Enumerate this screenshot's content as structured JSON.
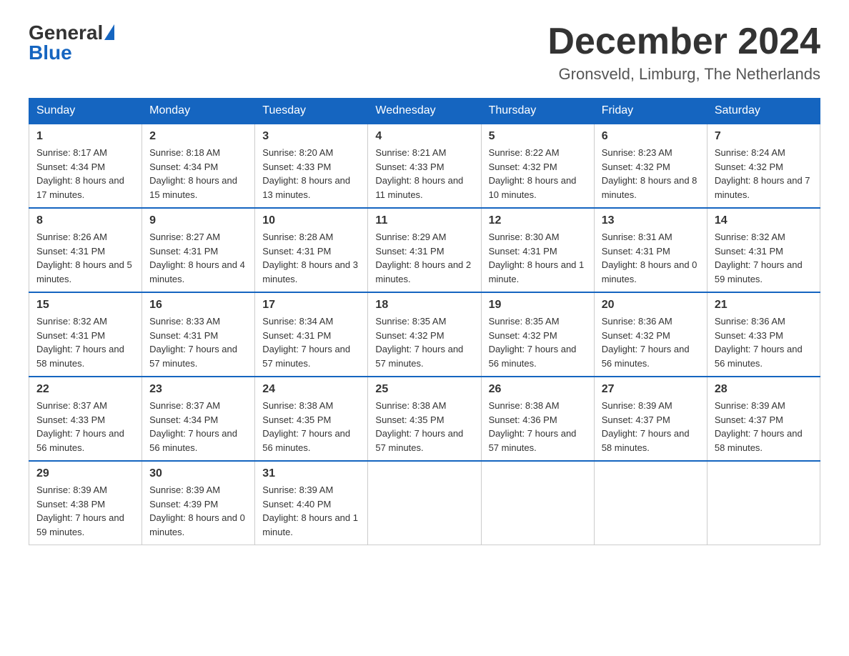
{
  "header": {
    "logo_general": "General",
    "logo_blue": "Blue",
    "month_title": "December 2024",
    "location": "Gronsveld, Limburg, The Netherlands"
  },
  "columns": [
    "Sunday",
    "Monday",
    "Tuesday",
    "Wednesday",
    "Thursday",
    "Friday",
    "Saturday"
  ],
  "weeks": [
    [
      {
        "day": "1",
        "sunrise": "8:17 AM",
        "sunset": "4:34 PM",
        "daylight": "8 hours and 17 minutes."
      },
      {
        "day": "2",
        "sunrise": "8:18 AM",
        "sunset": "4:34 PM",
        "daylight": "8 hours and 15 minutes."
      },
      {
        "day": "3",
        "sunrise": "8:20 AM",
        "sunset": "4:33 PM",
        "daylight": "8 hours and 13 minutes."
      },
      {
        "day": "4",
        "sunrise": "8:21 AM",
        "sunset": "4:33 PM",
        "daylight": "8 hours and 11 minutes."
      },
      {
        "day": "5",
        "sunrise": "8:22 AM",
        "sunset": "4:32 PM",
        "daylight": "8 hours and 10 minutes."
      },
      {
        "day": "6",
        "sunrise": "8:23 AM",
        "sunset": "4:32 PM",
        "daylight": "8 hours and 8 minutes."
      },
      {
        "day": "7",
        "sunrise": "8:24 AM",
        "sunset": "4:32 PM",
        "daylight": "8 hours and 7 minutes."
      }
    ],
    [
      {
        "day": "8",
        "sunrise": "8:26 AM",
        "sunset": "4:31 PM",
        "daylight": "8 hours and 5 minutes."
      },
      {
        "day": "9",
        "sunrise": "8:27 AM",
        "sunset": "4:31 PM",
        "daylight": "8 hours and 4 minutes."
      },
      {
        "day": "10",
        "sunrise": "8:28 AM",
        "sunset": "4:31 PM",
        "daylight": "8 hours and 3 minutes."
      },
      {
        "day": "11",
        "sunrise": "8:29 AM",
        "sunset": "4:31 PM",
        "daylight": "8 hours and 2 minutes."
      },
      {
        "day": "12",
        "sunrise": "8:30 AM",
        "sunset": "4:31 PM",
        "daylight": "8 hours and 1 minute."
      },
      {
        "day": "13",
        "sunrise": "8:31 AM",
        "sunset": "4:31 PM",
        "daylight": "8 hours and 0 minutes."
      },
      {
        "day": "14",
        "sunrise": "8:32 AM",
        "sunset": "4:31 PM",
        "daylight": "7 hours and 59 minutes."
      }
    ],
    [
      {
        "day": "15",
        "sunrise": "8:32 AM",
        "sunset": "4:31 PM",
        "daylight": "7 hours and 58 minutes."
      },
      {
        "day": "16",
        "sunrise": "8:33 AM",
        "sunset": "4:31 PM",
        "daylight": "7 hours and 57 minutes."
      },
      {
        "day": "17",
        "sunrise": "8:34 AM",
        "sunset": "4:31 PM",
        "daylight": "7 hours and 57 minutes."
      },
      {
        "day": "18",
        "sunrise": "8:35 AM",
        "sunset": "4:32 PM",
        "daylight": "7 hours and 57 minutes."
      },
      {
        "day": "19",
        "sunrise": "8:35 AM",
        "sunset": "4:32 PM",
        "daylight": "7 hours and 56 minutes."
      },
      {
        "day": "20",
        "sunrise": "8:36 AM",
        "sunset": "4:32 PM",
        "daylight": "7 hours and 56 minutes."
      },
      {
        "day": "21",
        "sunrise": "8:36 AM",
        "sunset": "4:33 PM",
        "daylight": "7 hours and 56 minutes."
      }
    ],
    [
      {
        "day": "22",
        "sunrise": "8:37 AM",
        "sunset": "4:33 PM",
        "daylight": "7 hours and 56 minutes."
      },
      {
        "day": "23",
        "sunrise": "8:37 AM",
        "sunset": "4:34 PM",
        "daylight": "7 hours and 56 minutes."
      },
      {
        "day": "24",
        "sunrise": "8:38 AM",
        "sunset": "4:35 PM",
        "daylight": "7 hours and 56 minutes."
      },
      {
        "day": "25",
        "sunrise": "8:38 AM",
        "sunset": "4:35 PM",
        "daylight": "7 hours and 57 minutes."
      },
      {
        "day": "26",
        "sunrise": "8:38 AM",
        "sunset": "4:36 PM",
        "daylight": "7 hours and 57 minutes."
      },
      {
        "day": "27",
        "sunrise": "8:39 AM",
        "sunset": "4:37 PM",
        "daylight": "7 hours and 58 minutes."
      },
      {
        "day": "28",
        "sunrise": "8:39 AM",
        "sunset": "4:37 PM",
        "daylight": "7 hours and 58 minutes."
      }
    ],
    [
      {
        "day": "29",
        "sunrise": "8:39 AM",
        "sunset": "4:38 PM",
        "daylight": "7 hours and 59 minutes."
      },
      {
        "day": "30",
        "sunrise": "8:39 AM",
        "sunset": "4:39 PM",
        "daylight": "8 hours and 0 minutes."
      },
      {
        "day": "31",
        "sunrise": "8:39 AM",
        "sunset": "4:40 PM",
        "daylight": "8 hours and 1 minute."
      },
      null,
      null,
      null,
      null
    ]
  ]
}
